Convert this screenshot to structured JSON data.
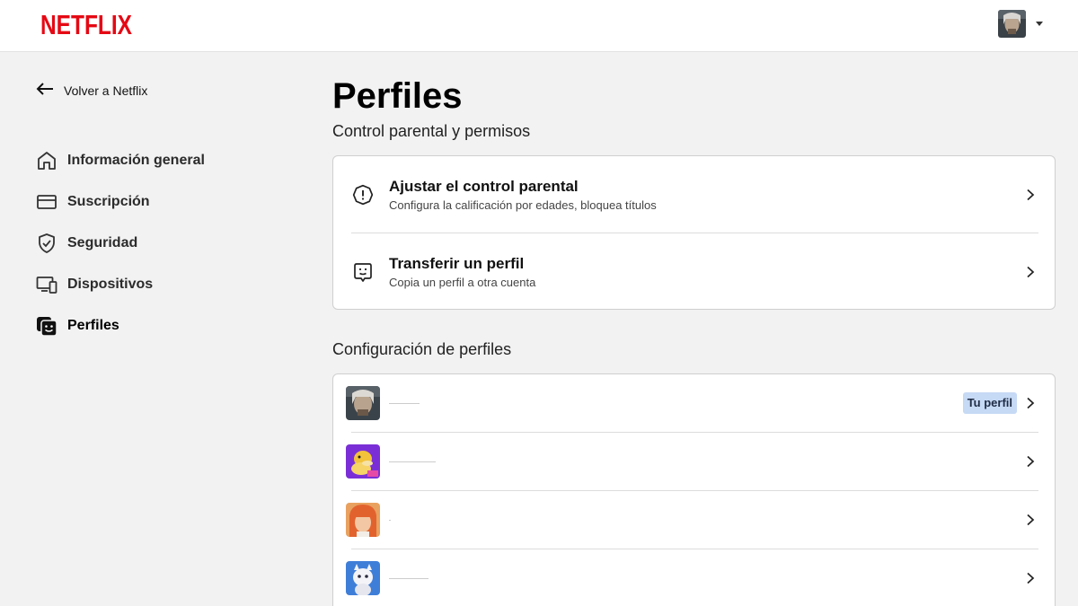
{
  "brand": {
    "name": "NETFLIX",
    "color": "#e50914"
  },
  "header": {
    "account_menu_icon": "caret-down-icon"
  },
  "sidebar": {
    "back_label": "Volver a Netflix",
    "items": [
      {
        "label": "Información general",
        "icon": "home-icon"
      },
      {
        "label": "Suscripción",
        "icon": "credit-card-icon"
      },
      {
        "label": "Seguridad",
        "icon": "shield-check-icon"
      },
      {
        "label": "Dispositivos",
        "icon": "devices-icon"
      },
      {
        "label": "Perfiles",
        "icon": "profiles-icon",
        "active": true
      }
    ]
  },
  "main": {
    "title": "Perfiles",
    "section1_title": "Control parental y permisos",
    "options": [
      {
        "title": "Ajustar el control parental",
        "description": "Configura la calificación por edades, bloquea títulos",
        "icon": "alert-octagon-icon"
      },
      {
        "title": "Transferir un perfil",
        "description": "Copia un perfil a otra cuenta",
        "icon": "profile-transfer-icon"
      }
    ],
    "section2_title": "Configuración de perfiles",
    "profiles": [
      {
        "badge": "Tu perfil"
      },
      {},
      {},
      {}
    ]
  },
  "colors": {
    "badge_bg": "#c6d9f5",
    "page_bg": "#f2f2f2"
  }
}
